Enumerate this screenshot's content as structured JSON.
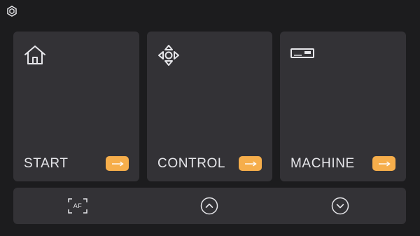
{
  "app": {
    "logo_icon": "hexagon-logo-icon"
  },
  "cards": [
    {
      "label": "START",
      "icon": "home-icon"
    },
    {
      "label": "CONTROL",
      "icon": "move-arrows-icon"
    },
    {
      "label": "MACHINE",
      "icon": "machine-display-icon"
    }
  ],
  "bottom_bar": {
    "af_label": "AF",
    "up_icon": "chevron-up-circle-icon",
    "down_icon": "chevron-down-circle-icon"
  },
  "colors": {
    "background": "#1c1c1e",
    "panel": "#333236",
    "accent": "#f6ae4b",
    "text": "#e6e6ea"
  }
}
